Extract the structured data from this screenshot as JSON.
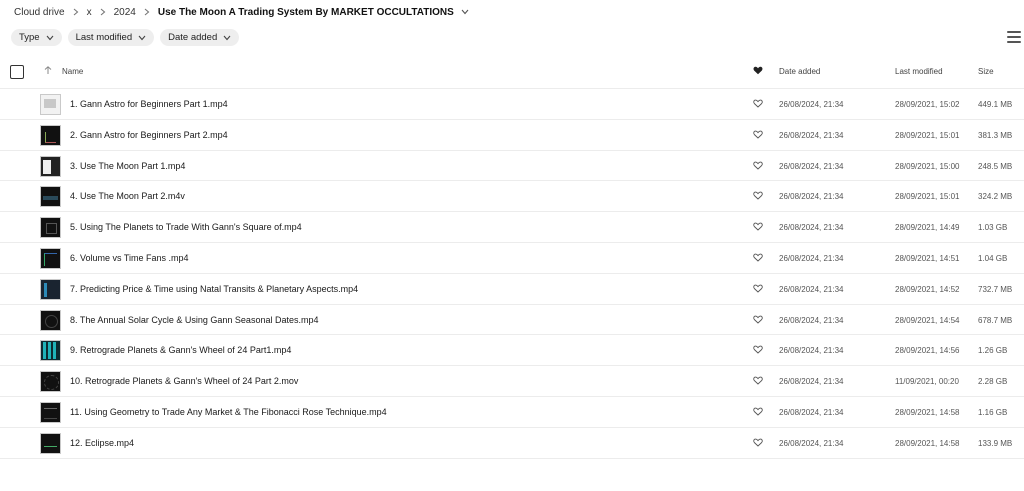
{
  "breadcrumb": {
    "items": [
      "Cloud drive",
      "x",
      "2024"
    ],
    "current": "Use The Moon A Trading System By MARKET OCCULTATIONS"
  },
  "filters": [
    {
      "label": "Type"
    },
    {
      "label": "Last modified"
    },
    {
      "label": "Date added"
    }
  ],
  "columns": {
    "name": "Name",
    "date_added": "Date added",
    "last_modified": "Last modified",
    "size": "Size"
  },
  "icons": {
    "breadcrumb_separator": "chevron-right-icon",
    "dropdown": "chevron-down-icon",
    "sort": "arrow-up-icon",
    "favourite_header": "heart-filled-icon",
    "favourite_row": "heart-outline-icon",
    "view_toggle": "list-view-icon"
  },
  "files": [
    {
      "name": "1. Gann Astro for Beginners Part 1.mp4",
      "added": "26/08/2024, 21:34",
      "modified": "28/09/2021, 15:02",
      "size": "449.1 MB"
    },
    {
      "name": "2. Gann Astro for Beginners Part 2.mp4",
      "added": "26/08/2024, 21:34",
      "modified": "28/09/2021, 15:01",
      "size": "381.3 MB"
    },
    {
      "name": "3. Use The Moon Part 1.mp4",
      "added": "26/08/2024, 21:34",
      "modified": "28/09/2021, 15:00",
      "size": "248.5 MB"
    },
    {
      "name": "4. Use The Moon Part 2.m4v",
      "added": "26/08/2024, 21:34",
      "modified": "28/09/2021, 15:01",
      "size": "324.2 MB"
    },
    {
      "name": "5. Using The Planets to Trade With Gann's Square of.mp4",
      "added": "26/08/2024, 21:34",
      "modified": "28/09/2021, 14:49",
      "size": "1.03 GB"
    },
    {
      "name": "6. Volume vs Time Fans .mp4",
      "added": "26/08/2024, 21:34",
      "modified": "28/09/2021, 14:51",
      "size": "1.04 GB"
    },
    {
      "name": "7. Predicting Price & Time using Natal Transits & Planetary Aspects.mp4",
      "added": "26/08/2024, 21:34",
      "modified": "28/09/2021, 14:52",
      "size": "732.7 MB"
    },
    {
      "name": "8. The Annual Solar Cycle & Using Gann Seasonal Dates.mp4",
      "added": "26/08/2024, 21:34",
      "modified": "28/09/2021, 14:54",
      "size": "678.7 MB"
    },
    {
      "name": "9. Retrograde Planets & Gann's Wheel of 24 Part1.mp4",
      "added": "26/08/2024, 21:34",
      "modified": "28/09/2021, 14:56",
      "size": "1.26 GB"
    },
    {
      "name": "10. Retrograde Planets & Gann's Wheel of 24 Part 2.mov",
      "added": "26/08/2024, 21:34",
      "modified": "11/09/2021, 00:20",
      "size": "2.28 GB"
    },
    {
      "name": "11. Using Geometry to Trade Any Market & The Fibonacci Rose Technique.mp4",
      "added": "26/08/2024, 21:34",
      "modified": "28/09/2021, 14:58",
      "size": "1.16 GB"
    },
    {
      "name": "12. Eclipse.mp4",
      "added": "26/08/2024, 21:34",
      "modified": "28/09/2021, 14:58",
      "size": "133.9 MB"
    }
  ]
}
